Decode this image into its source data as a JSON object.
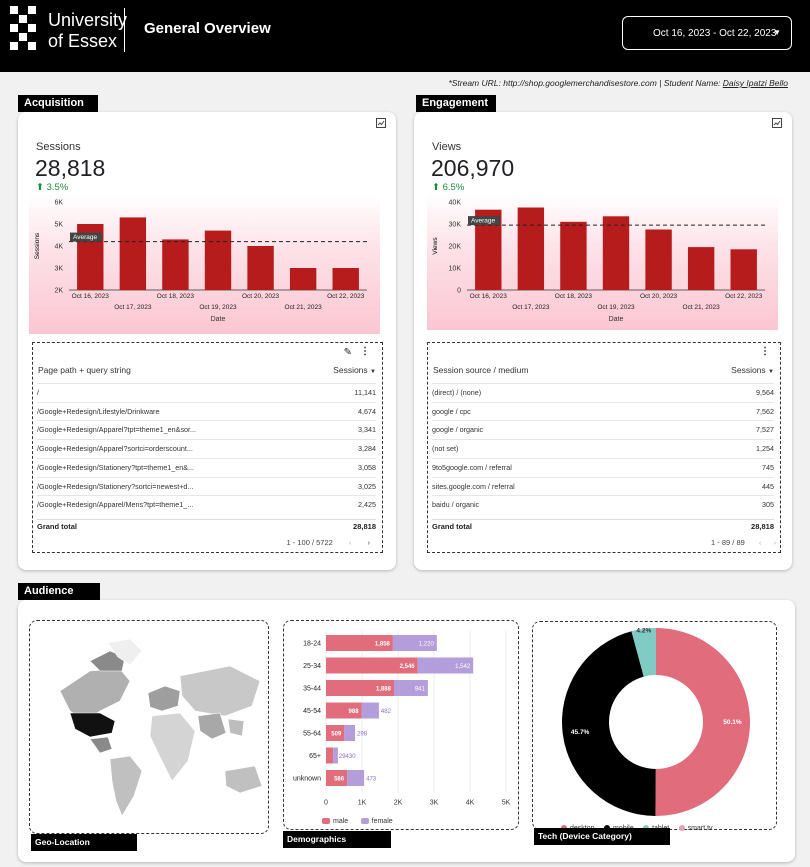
{
  "header": {
    "logo_line1": "University",
    "logo_line2": "of Essex",
    "title": "General Overview",
    "date_range": "Oct 16, 2023 - Oct 22, 2023"
  },
  "stream_info": {
    "prefix": "*Stream URL: http://shop.googlemerchandisestore.com | Student Name: ",
    "student": "Daisy Ipatzi Bello"
  },
  "acquisition": {
    "tag": "Acquisition",
    "kpi_label": "Sessions",
    "kpi_value": "28,818",
    "kpi_delta": "3.5%",
    "table": {
      "col1": "Page path + query string",
      "col2": "Sessions",
      "rows": [
        {
          "label": "/",
          "value": "11,141"
        },
        {
          "label": "/Google+Redesign/Lifestyle/Drinkware",
          "value": "4,674"
        },
        {
          "label": "/Google+Redesign/Apparel?tpt=theme1_en&sor...",
          "value": "3,341"
        },
        {
          "label": "/Google+Redesign/Apparel?sortci=orderscount...",
          "value": "3,284"
        },
        {
          "label": "/Google+Redesign/Stationery?tpt=theme1_en&...",
          "value": "3,058"
        },
        {
          "label": "/Google+Redesign/Stationery?sortci=newest+d...",
          "value": "3,025"
        },
        {
          "label": "/Google+Redesign/Apparel/Mens?tpt=theme1_...",
          "value": "2,425"
        }
      ],
      "total_label": "Grand total",
      "total_value": "28,818",
      "pager": "1 - 100 / 5722"
    }
  },
  "engagement": {
    "tag": "Engagement",
    "kpi_label": "Views",
    "kpi_value": "206,970",
    "kpi_delta": "6.5%",
    "table": {
      "col1": "Session source / medium",
      "col2": "Sessions",
      "rows": [
        {
          "label": "(direct) / (none)",
          "value": "9,564"
        },
        {
          "label": "google / cpc",
          "value": "7,562"
        },
        {
          "label": "google / organic",
          "value": "7,527"
        },
        {
          "label": "(not set)",
          "value": "1,254"
        },
        {
          "label": "9to5google.com / referral",
          "value": "745"
        },
        {
          "label": "sites.google.com / referral",
          "value": "445"
        },
        {
          "label": "baidu / organic",
          "value": "305"
        }
      ],
      "total_label": "Grand total",
      "total_value": "28,818",
      "pager": "1 - 89 / 89"
    }
  },
  "audience": {
    "tag": "Audience",
    "geo_label": "Geo-Location",
    "demo_label": "Demographics",
    "tech_label": "Tech (Device Category)"
  },
  "chart_data": [
    {
      "type": "bar",
      "ylabel": "Sessions",
      "xlabel": "Date",
      "categories": [
        "Oct 16, 2023",
        "Oct 17, 2023",
        "Oct 18, 2023",
        "Oct 19, 2023",
        "Oct 20, 2023",
        "Oct 21, 2023",
        "Oct 22, 2023"
      ],
      "values": [
        5000,
        5300,
        4300,
        4700,
        4000,
        3000,
        3000
      ],
      "yticks": [
        "2K",
        "3K",
        "4K",
        "5K",
        "6K"
      ],
      "ylim": [
        2000,
        6000
      ],
      "reference_line": {
        "label": "Average",
        "value": 4200
      },
      "color": "#b71c1c"
    },
    {
      "type": "bar",
      "ylabel": "Views",
      "xlabel": "Date",
      "categories": [
        "Oct 16, 2023",
        "Oct 17, 2023",
        "Oct 18, 2023",
        "Oct 19, 2023",
        "Oct 20, 2023",
        "Oct 21, 2023",
        "Oct 22, 2023"
      ],
      "values": [
        36500,
        37500,
        31000,
        33500,
        27500,
        19500,
        18500
      ],
      "yticks": [
        "0",
        "10K",
        "20K",
        "30K",
        "40K"
      ],
      "ylim": [
        0,
        40000
      ],
      "reference_line": {
        "label": "Average",
        "value": 29500
      },
      "color": "#b71c1c"
    },
    {
      "type": "bar",
      "orientation": "horizontal",
      "stacked": true,
      "categories": [
        "18-24",
        "25-34",
        "35-44",
        "45-54",
        "55-64",
        "65+",
        "unknown"
      ],
      "series": [
        {
          "name": "male",
          "values": [
            1858,
            2546,
            1888,
            988,
            509,
            200,
            586
          ],
          "labels": [
            "1,858",
            "2,546",
            "1,888",
            "988",
            "509",
            "",
            "586"
          ],
          "color": "#e06c7c"
        },
        {
          "name": "female",
          "values": [
            1220,
            1542,
            941,
            482,
            298,
            130,
            473
          ],
          "labels": [
            "1,220",
            "1,542",
            "941",
            "482",
            "298",
            "",
            "473"
          ],
          "color": "#b39ddb"
        }
      ],
      "overlap_label": "29430",
      "xticks": [
        "0",
        "1K",
        "2K",
        "3K",
        "4K",
        "5K"
      ],
      "xlim": [
        0,
        5000
      ]
    },
    {
      "type": "pie",
      "donut": true,
      "slices": [
        {
          "name": "desktop",
          "value": 50.1,
          "label": "50.1%",
          "color": "#e06c7c"
        },
        {
          "name": "mobile",
          "value": 45.7,
          "label": "45.7%",
          "color": "#000000"
        },
        {
          "name": "tablet",
          "value": 4.2,
          "label": "4.2%",
          "color": "#80cbc4"
        },
        {
          "name": "smart tv",
          "value": 0.0,
          "label": "",
          "color": "#e8a0b0"
        }
      ]
    }
  ]
}
